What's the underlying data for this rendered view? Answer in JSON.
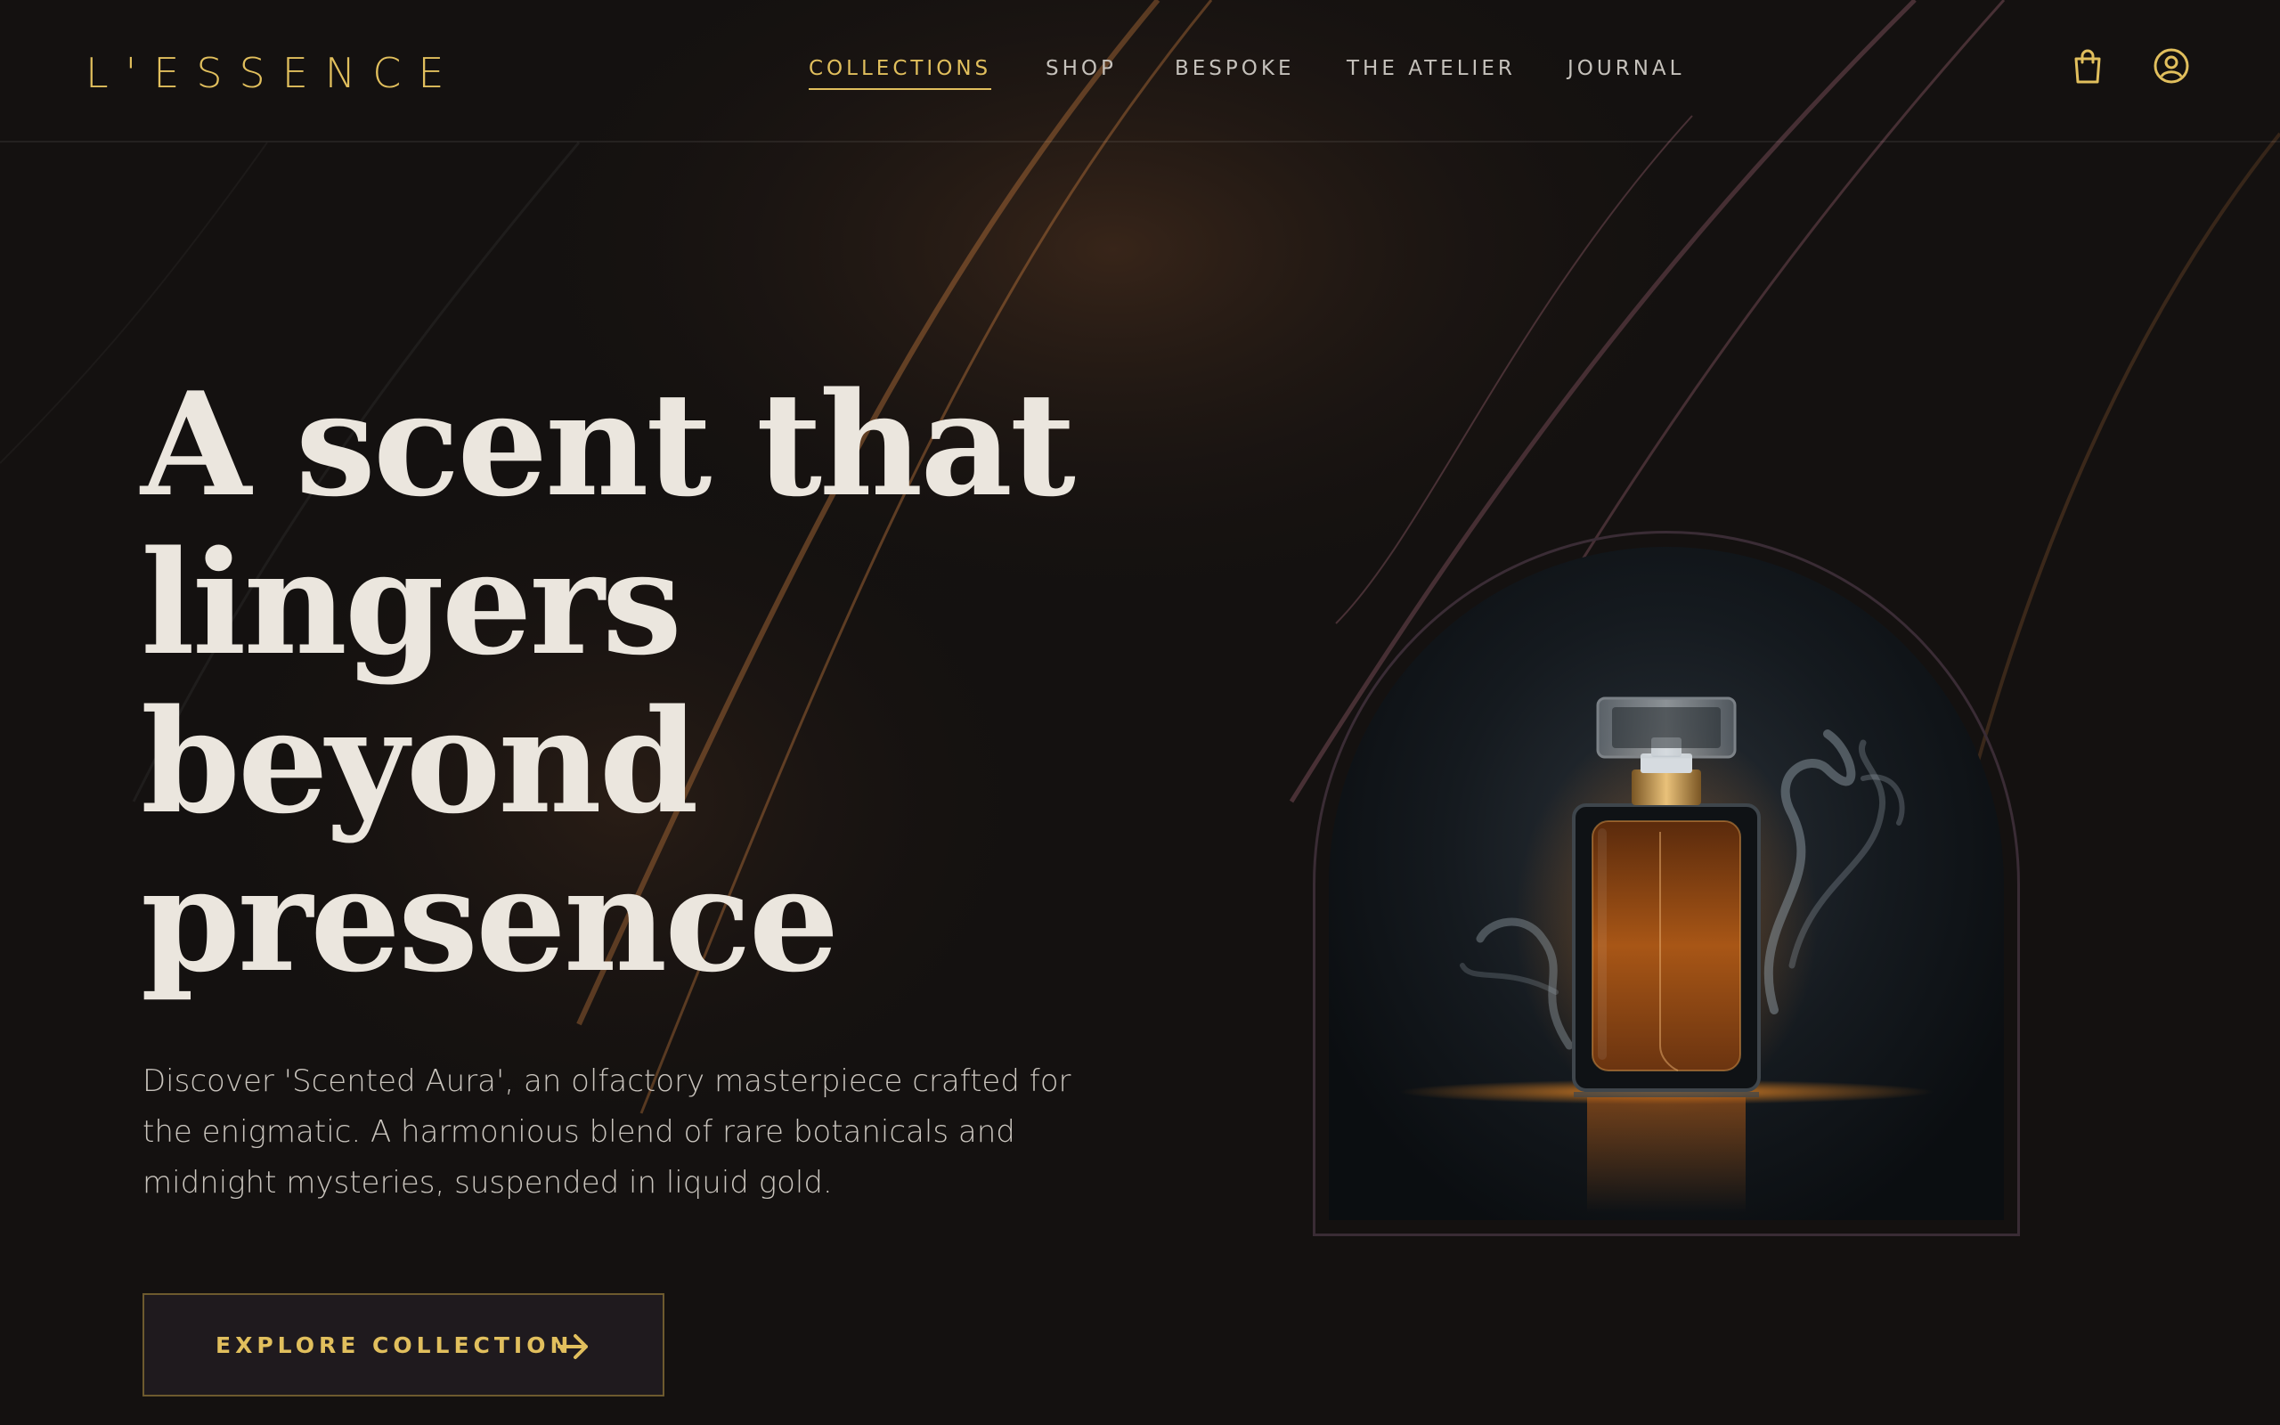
{
  "brand": {
    "logo": "L'ESSENCE"
  },
  "nav": {
    "items": [
      {
        "label": "COLLECTIONS",
        "active": true
      },
      {
        "label": "SHOP",
        "active": false
      },
      {
        "label": "BESPOKE",
        "active": false
      },
      {
        "label": "THE ATELIER",
        "active": false
      },
      {
        "label": "JOURNAL",
        "active": false
      }
    ],
    "icons": [
      "shopping-bag-icon",
      "user-account-icon"
    ]
  },
  "hero": {
    "title_lines": [
      "A scent that",
      "lingers",
      "beyond",
      "presence"
    ],
    "description": "Discover 'Scented Aura', an olfactory masterpiece crafted for the enigmatic. A harmonious blend of rare botanicals and midnight mysteries, suspended in liquid gold.",
    "cta_label": "EXPLORE COLLECTION",
    "cta_icon": "arrow-right-icon"
  },
  "product_image": {
    "subject": "perfume-bottle"
  },
  "colors": {
    "accent_gold": "#e1bf5d",
    "background": "#141110",
    "text_light": "#ebe6de",
    "amber": "#c7741d"
  }
}
